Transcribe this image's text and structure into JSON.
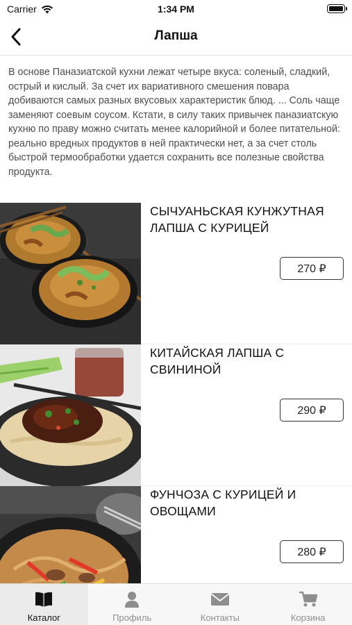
{
  "status_bar": {
    "carrier": "Carrier",
    "time": "1:34 PM"
  },
  "nav": {
    "title": "Лапша",
    "back_icon": "chevron-left-icon"
  },
  "intro_text": "В основе Паназиатской  кухни лежат четыре вкуса: соленый, сладкий, острый и кислый. За счет их вариативного смешения повара добиваются самых разных вкусовых характеристик блюд. ... Соль чаще заменяют соевым соусом. Кстати, в силу таких привычек паназиатскую кухню по праву можно считать менее калорийной и более питательной: реально вредных продуктов в ней практически нет, а за счет столь быстрой термообработки удается сохранить все полезные свойства продукта.",
  "products": [
    {
      "name": "СЫЧУАНЬСКАЯ КУНЖУТНАЯ ЛАПША С КУРИЦЕЙ",
      "price": "270 ₽"
    },
    {
      "name": "КИТАЙСКАЯ ЛАПША С СВИНИНОЙ",
      "price": "290 ₽"
    },
    {
      "name": "ФУНЧОЗА С КУРИЦЕЙ И ОВОЩАМИ",
      "price": "280 ₽"
    }
  ],
  "tabs": [
    {
      "label": "Каталог",
      "icon": "book-icon",
      "active": true
    },
    {
      "label": "Профиль",
      "icon": "person-icon",
      "active": false
    },
    {
      "label": "Контакты",
      "icon": "envelope-icon",
      "active": false
    },
    {
      "label": "Корзина",
      "icon": "cart-icon",
      "active": false
    }
  ],
  "colors": {
    "accent_active": "#111111",
    "tab_inactive": "#8e8e8e",
    "tab_bar_bg": "#f7f7f7"
  }
}
